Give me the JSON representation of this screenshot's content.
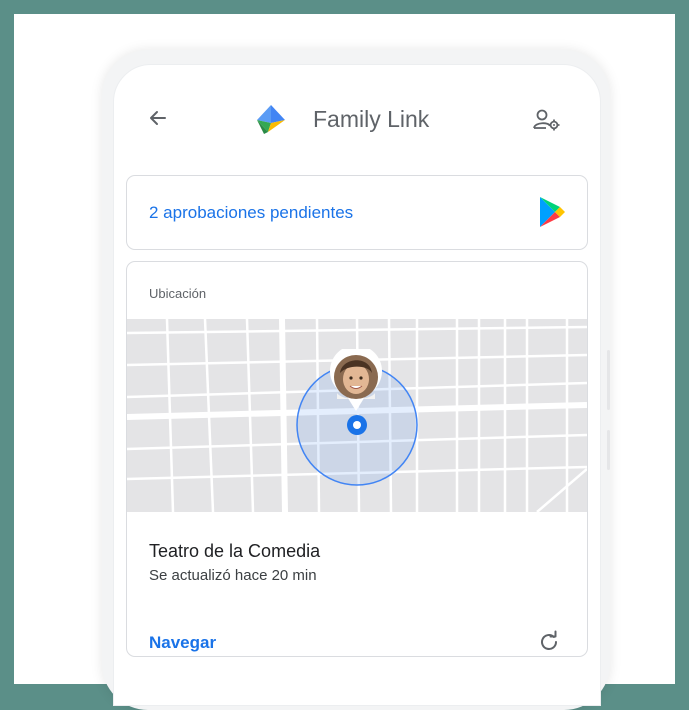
{
  "header": {
    "back_icon": "arrow-left-icon",
    "logo_icon": "family-link-logo",
    "title": "Family Link",
    "account_icon": "manage-account-icon"
  },
  "approvals": {
    "label": "2 aprobaciones pendientes",
    "icon": "google-play-icon"
  },
  "location": {
    "section_label": "Ubicación",
    "place_name": "Teatro de la Comedia",
    "updated_text": "Se actualizó hace 20 min",
    "navigate_label": "Navegar",
    "refresh_icon": "refresh-icon",
    "marker_icon": "location-dot-icon"
  },
  "colors": {
    "background": "#5b8f88",
    "accent": "#1a73e8",
    "map_circle": "#4285f4"
  }
}
